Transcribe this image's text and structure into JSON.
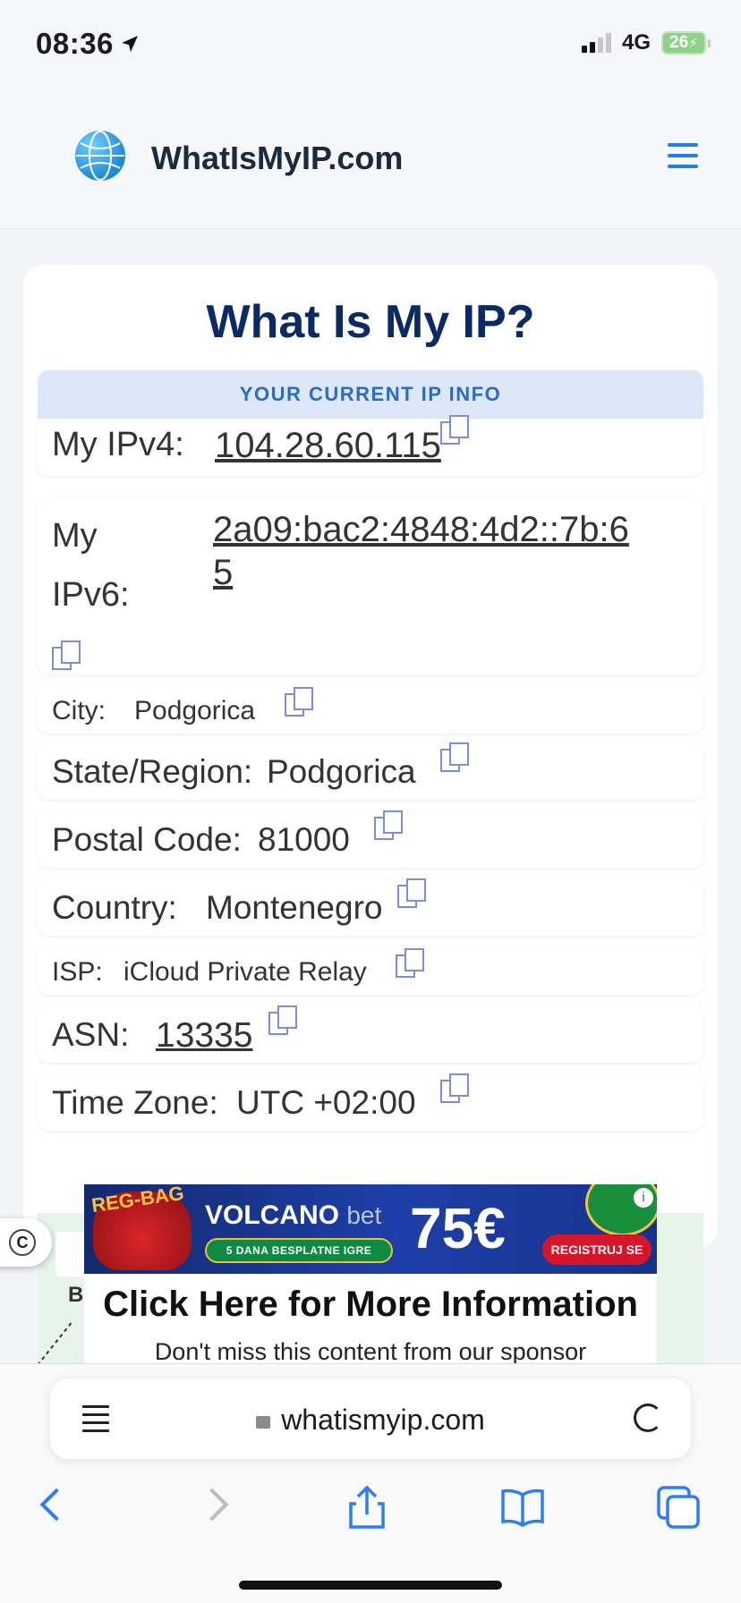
{
  "status": {
    "time": "08:36",
    "network": "4G",
    "battery": "26"
  },
  "header": {
    "brand": "WhatIsMyIP.com"
  },
  "main": {
    "title": "What Is My IP?",
    "section": "YOUR CURRENT IP INFO",
    "ipv4": {
      "label": "My IPv4:",
      "value": "104.28.60.115"
    },
    "ipv6": {
      "label_line1": "My",
      "label_line2": "IPv6:",
      "value_line1": "2a09:bac2:4848:4d2::7b:6",
      "value_line2": "5"
    },
    "city": {
      "label": "City:",
      "value": "Podgorica"
    },
    "state": {
      "label": "State/Region:",
      "value": "Podgorica"
    },
    "postal": {
      "label": "Postal Code:",
      "value": "81000"
    },
    "country": {
      "label": "Country:",
      "value": "Montenegro"
    },
    "isp": {
      "label": "ISP:",
      "value": "iCloud Private Relay"
    },
    "asn": {
      "label": "ASN:",
      "value": "13335"
    },
    "timezone": {
      "label": "Time Zone:",
      "value": "UTC +02:00"
    }
  },
  "map": {
    "label": "B",
    "control": "C"
  },
  "ad": {
    "tag": "REG-BAG",
    "brand": "VOLCANO",
    "brand_suffix": "bet",
    "promo": "5 DANA BESPLATNE IGRE",
    "amount": "75€",
    "cta": "REGISTRUJ SE",
    "info": "i",
    "title": "Click Here for More Information",
    "subtitle": "Don't miss this content from our sponsor"
  },
  "browser": {
    "url": "whatismyip.com"
  }
}
